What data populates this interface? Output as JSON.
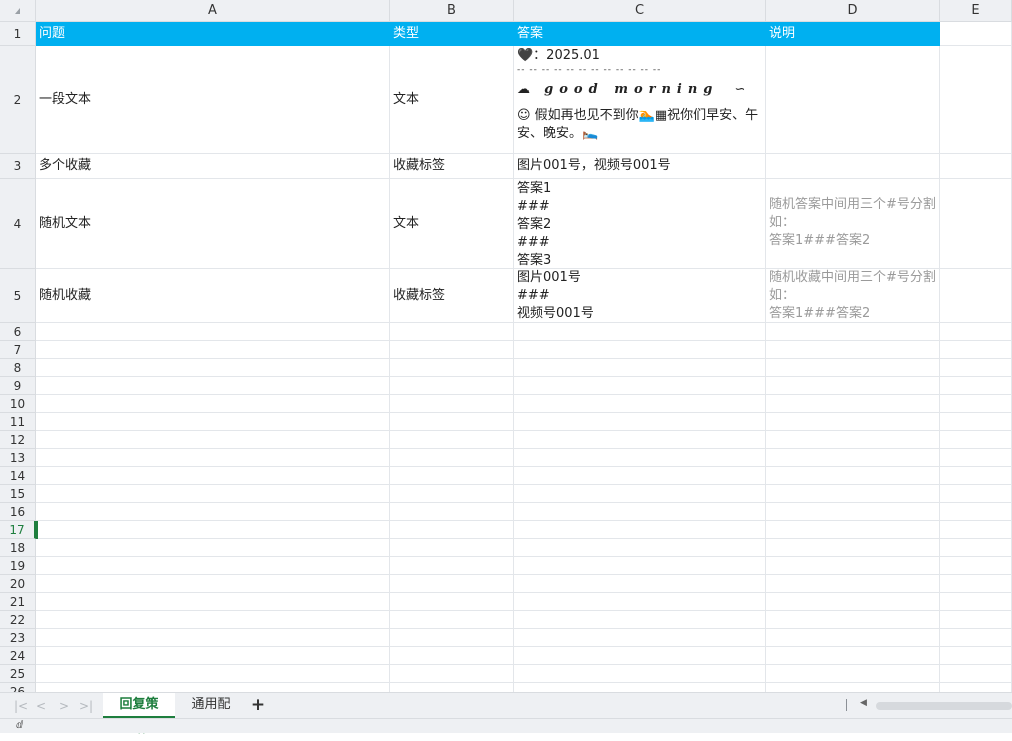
{
  "columns": [
    "A",
    "B",
    "C",
    "D",
    "E"
  ],
  "rows": [
    "1",
    "2",
    "3",
    "4",
    "5",
    "6",
    "7",
    "8",
    "9",
    "10",
    "11",
    "12",
    "13",
    "14",
    "15",
    "16",
    "17",
    "18",
    "19",
    "20",
    "21",
    "22",
    "23",
    "24",
    "25",
    "26"
  ],
  "header": {
    "a": "问题",
    "b": "类型",
    "c": "答案",
    "d": "说明"
  },
  "r2": {
    "a": "一段文本",
    "b": "文本",
    "c_line1": "🖤：2025.01",
    "c_dashes": "-- -- -- -- -- -- -- -- -- -- -- --",
    "c_gm_icon": "☁",
    "c_gm": "good morning",
    "c_gm_end": "∽",
    "c_line3": "☺ 假如再也见不到你🏊▦祝你们早安、午安、晚安。🛌"
  },
  "r3": {
    "a": "多个收藏",
    "b": "收藏标签",
    "c": "图片001号，视频号001号"
  },
  "r4": {
    "a": "随机文本",
    "b": "文本",
    "c": "答案1\n###\n答案2\n###\n答案3",
    "d": "随机答案中间用三个#号分割如：\n答案1###答案2"
  },
  "r5": {
    "a": "随机收藏",
    "b": "收藏标签",
    "c": "图片001号\n###\n视频号001号",
    "d": "随机收藏中间用三个#号分割如：\n答案1###答案2"
  },
  "selected_row": "17",
  "tabs": [
    {
      "label": "回复策略",
      "active": true
    },
    {
      "label": "通用配置",
      "active": false
    }
  ],
  "add_tab": "+",
  "nav": {
    "first": "|<",
    "prev": "<",
    "next": ">",
    "last": ">|"
  },
  "status_icon": "ⅆ",
  "colors": {
    "header_bg": "#00b0f0",
    "accent": "#1e7e3e",
    "note_gray": "#9a9a9a"
  }
}
